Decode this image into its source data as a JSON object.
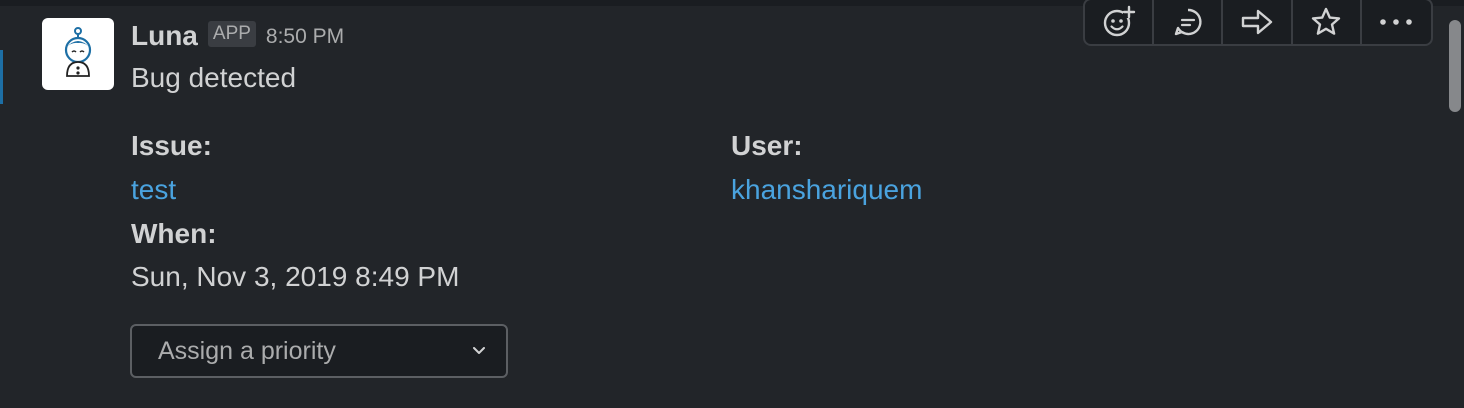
{
  "message": {
    "sender": "Luna",
    "badge": "APP",
    "time": "8:50 PM",
    "text": "Bug detected"
  },
  "fields": {
    "issue_label": "Issue:",
    "issue_value": "test",
    "user_label": "User:",
    "user_value": "khanshariquem",
    "when_label": "When:",
    "when_value": "Sun, Nov 3, 2019 8:49 PM"
  },
  "priority_select": {
    "selected": "Assign a priority"
  },
  "toolbar": {
    "icons": [
      "add-reaction-icon",
      "reply-thread-icon",
      "share-icon",
      "star-icon",
      "more-actions-icon"
    ]
  },
  "colors": {
    "background": "#222529",
    "link": "#4aa3df",
    "text": "#d1d2d3",
    "accent": "#1d6fa5"
  }
}
